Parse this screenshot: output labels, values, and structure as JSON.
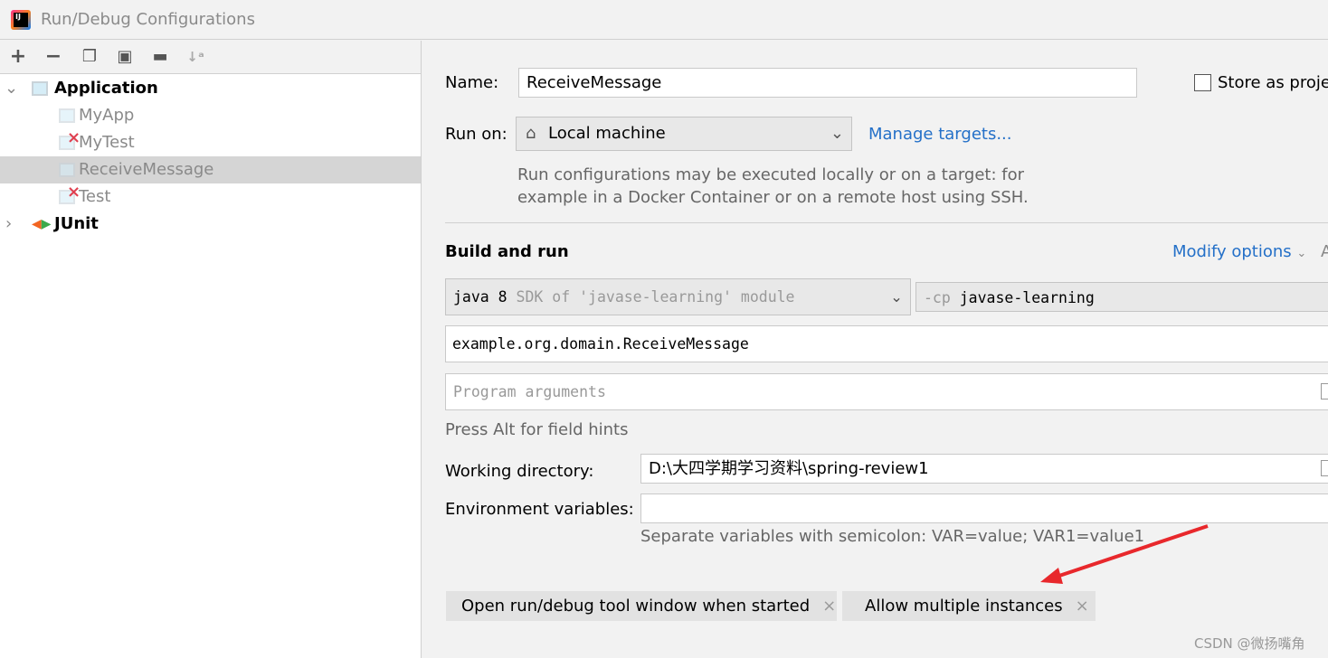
{
  "window": {
    "title": "Run/Debug Configurations"
  },
  "toolbar": {
    "icons": [
      "plus-icon",
      "minus-icon",
      "copy-icon",
      "save-icon",
      "add-folder-icon",
      "sort-az-icon"
    ]
  },
  "tree": {
    "groups": [
      {
        "label": "Application",
        "expanded": true,
        "children": [
          {
            "label": "MyApp",
            "error": false
          },
          {
            "label": "MyTest",
            "error": true
          },
          {
            "label": "ReceiveMessage",
            "error": false,
            "selected": true
          },
          {
            "label": "Test",
            "error": true
          }
        ]
      },
      {
        "label": "JUnit",
        "expanded": false
      }
    ]
  },
  "form": {
    "name_label": "Name:",
    "name_value": "ReceiveMessage",
    "store_label": "Store as projec",
    "store_checked": false,
    "run_on_label": "Run on:",
    "run_on_value": "Local machine",
    "manage_targets": "Manage targets...",
    "run_on_hint_1": "Run configurations may be executed locally or on a target: for",
    "run_on_hint_2": "example in a Docker Container or on a remote host using SSH.",
    "build_run_title": "Build and run",
    "modify_options": "Modify options",
    "modify_shortcut": "A",
    "sdk_main": "java 8",
    "sdk_hint": "SDK of 'javase-learning' module",
    "cp_prefix": "-cp",
    "cp_value": "javase-learning",
    "main_class": "example.org.domain.ReceiveMessage",
    "program_args_placeholder": "Program arguments",
    "field_hints": "Press Alt for field hints",
    "workdir_label": "Working directory:",
    "workdir_value": "D:\\大四学期学习资料\\spring-review1",
    "env_label": "Environment variables:",
    "env_value": "",
    "env_hint": "Separate variables with semicolon: VAR=value; VAR1=value1"
  },
  "chips": [
    {
      "label": "Open run/debug tool window when started"
    },
    {
      "label": "Allow multiple instances"
    }
  ],
  "watermark": "CSDN @微扬嘴角",
  "colors": {
    "link": "#2470c8",
    "arrow": "#e8282c",
    "selection": "#d5d5d5"
  }
}
